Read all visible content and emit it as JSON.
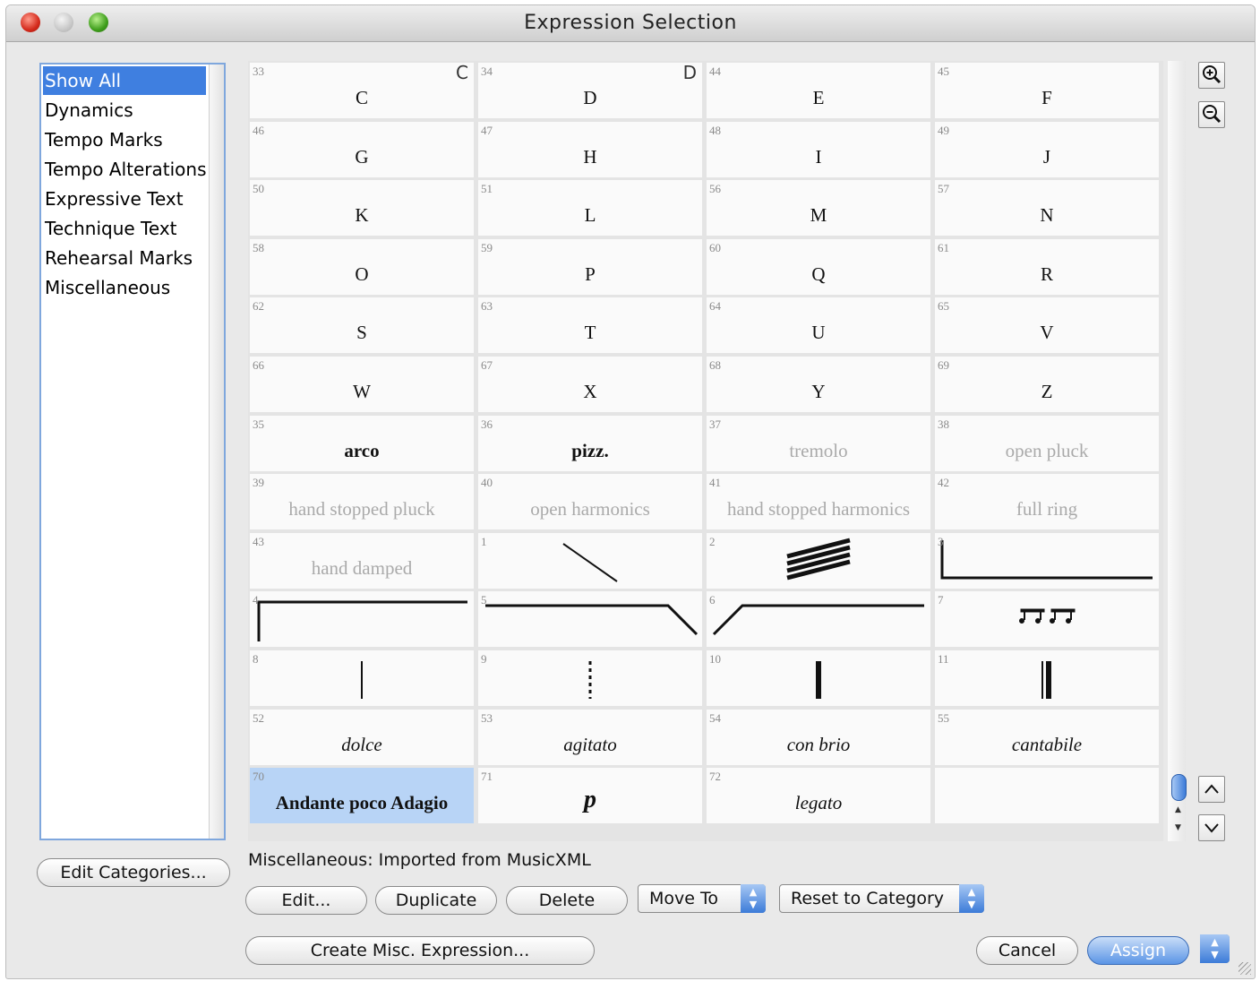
{
  "window": {
    "title": "Expression Selection"
  },
  "categories": {
    "items": [
      "Show All",
      "Dynamics",
      "Tempo Marks",
      "Tempo Alterations",
      "Expressive Text",
      "Technique Text",
      "Rehearsal Marks",
      "Miscellaneous"
    ],
    "selected": "Show All"
  },
  "grid": {
    "cells": [
      {
        "num": "33",
        "text": "C",
        "glyph": "C"
      },
      {
        "num": "34",
        "text": "D",
        "glyph": "D"
      },
      {
        "num": "44",
        "text": "E"
      },
      {
        "num": "45",
        "text": "F"
      },
      {
        "num": "46",
        "text": "G"
      },
      {
        "num": "47",
        "text": "H"
      },
      {
        "num": "48",
        "text": "I"
      },
      {
        "num": "49",
        "text": "J"
      },
      {
        "num": "50",
        "text": "K"
      },
      {
        "num": "51",
        "text": "L"
      },
      {
        "num": "56",
        "text": "M"
      },
      {
        "num": "57",
        "text": "N"
      },
      {
        "num": "58",
        "text": "O"
      },
      {
        "num": "59",
        "text": "P"
      },
      {
        "num": "60",
        "text": "Q"
      },
      {
        "num": "61",
        "text": "R"
      },
      {
        "num": "62",
        "text": "S"
      },
      {
        "num": "63",
        "text": "T"
      },
      {
        "num": "64",
        "text": "U"
      },
      {
        "num": "65",
        "text": "V"
      },
      {
        "num": "66",
        "text": "W"
      },
      {
        "num": "67",
        "text": "X"
      },
      {
        "num": "68",
        "text": "Y"
      },
      {
        "num": "69",
        "text": "Z"
      },
      {
        "num": "35",
        "text": "arco",
        "style": "bold"
      },
      {
        "num": "36",
        "text": "pizz.",
        "style": "bold"
      },
      {
        "num": "37",
        "text": "tremolo",
        "style": "faint"
      },
      {
        "num": "38",
        "text": "open pluck",
        "style": "faint"
      },
      {
        "num": "39",
        "text": "hand stopped pluck",
        "style": "faint"
      },
      {
        "num": "40",
        "text": "open harmonics",
        "style": "faint"
      },
      {
        "num": "41",
        "text": "hand stopped harmonics",
        "style": "faint"
      },
      {
        "num": "42",
        "text": "full ring",
        "style": "faint"
      },
      {
        "num": "43",
        "text": "hand damped",
        "style": "faint"
      },
      {
        "num": "1",
        "text": "",
        "shape": "diag-line"
      },
      {
        "num": "2",
        "text": "",
        "shape": "tremolo-bars"
      },
      {
        "num": "3",
        "text": "",
        "shape": "bracket-left"
      },
      {
        "num": "4",
        "text": "",
        "shape": "bracket-left-top"
      },
      {
        "num": "5",
        "text": "",
        "shape": "line-right-down"
      },
      {
        "num": "6",
        "text": "",
        "shape": "line-left-up"
      },
      {
        "num": "7",
        "text": "",
        "shape": "notes"
      },
      {
        "num": "8",
        "text": "",
        "shape": "thin-bar"
      },
      {
        "num": "9",
        "text": "",
        "shape": "dashed-bar"
      },
      {
        "num": "10",
        "text": "",
        "shape": "thick-bar"
      },
      {
        "num": "11",
        "text": "",
        "shape": "double-bar"
      },
      {
        "num": "52",
        "text": "dolce",
        "style": "ital"
      },
      {
        "num": "53",
        "text": "agitato",
        "style": "ital"
      },
      {
        "num": "54",
        "text": "con brio",
        "style": "ital"
      },
      {
        "num": "55",
        "text": "cantabile",
        "style": "ital"
      },
      {
        "num": "70",
        "text": "Andante poco Adagio",
        "style": "bold",
        "selected": true
      },
      {
        "num": "71",
        "text": "p",
        "style": "bolditalic"
      },
      {
        "num": "72",
        "text": "legato",
        "style": "ital"
      },
      {
        "num": "",
        "text": ""
      }
    ]
  },
  "zoom": {
    "in_icon": "zoom-in-icon",
    "out_icon": "zoom-out-icon"
  },
  "status": {
    "text": "Miscellaneous: Imported from MusicXML"
  },
  "buttons": {
    "edit_categories": "Edit Categories...",
    "edit": "Edit...",
    "duplicate": "Duplicate",
    "delete": "Delete",
    "move_to": "Move To",
    "reset_to_category": "Reset to Category",
    "create_misc": "Create Misc. Expression...",
    "cancel": "Cancel",
    "assign": "Assign"
  },
  "colors": {
    "selection": "#3f7fe0",
    "selected_cell": "#b8d4f6",
    "accent": "#5b95e6"
  }
}
